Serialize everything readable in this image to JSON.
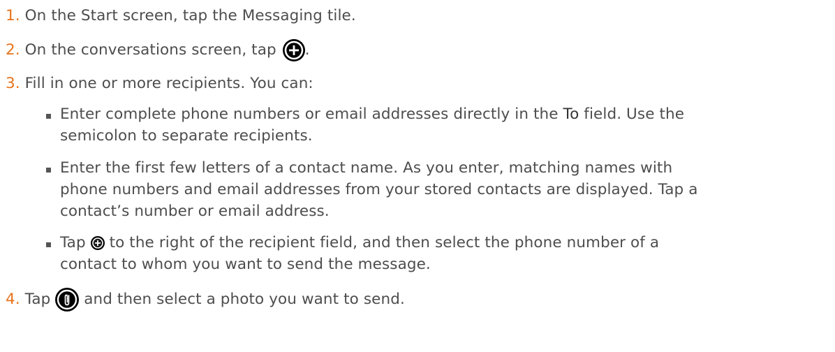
{
  "steps": [
    {
      "num": "1.",
      "text": "On the Start screen, tap the Messaging tile."
    },
    {
      "num": "2.",
      "text_before": "On the conversations screen, tap",
      "text_after": ".",
      "icon": "add-circle-icon"
    },
    {
      "num": "3.",
      "text": "Fill in one or more recipients. You can:"
    },
    {
      "num": "4.",
      "text_before": "Tap",
      "text_after": "and then select a photo you want to send.",
      "icon": "attach-paperclip-icon"
    }
  ],
  "bullets": [
    {
      "line1_before": "Enter complete phone numbers or email addresses directly in the",
      "line1_bold": "To",
      "line1_after": "field. Use the",
      "line2": "semicolon to separate recipients."
    },
    {
      "line1": "Enter the first few letters of a contact name. As you enter, matching names with",
      "line2": "phone numbers and email addresses from your stored contacts are displayed. Tap a",
      "line3": "contact’s number or email address."
    },
    {
      "line1_before": "Tap",
      "line1_after": "to the right of the recipient field, and then select the phone number of a",
      "line2": "contact to whom you want to send the message.",
      "icon": "add-circle-small-icon"
    }
  ],
  "colors": {
    "number": "#e8731b",
    "text": "#4d4d4d",
    "icon_bg": "#000000"
  }
}
